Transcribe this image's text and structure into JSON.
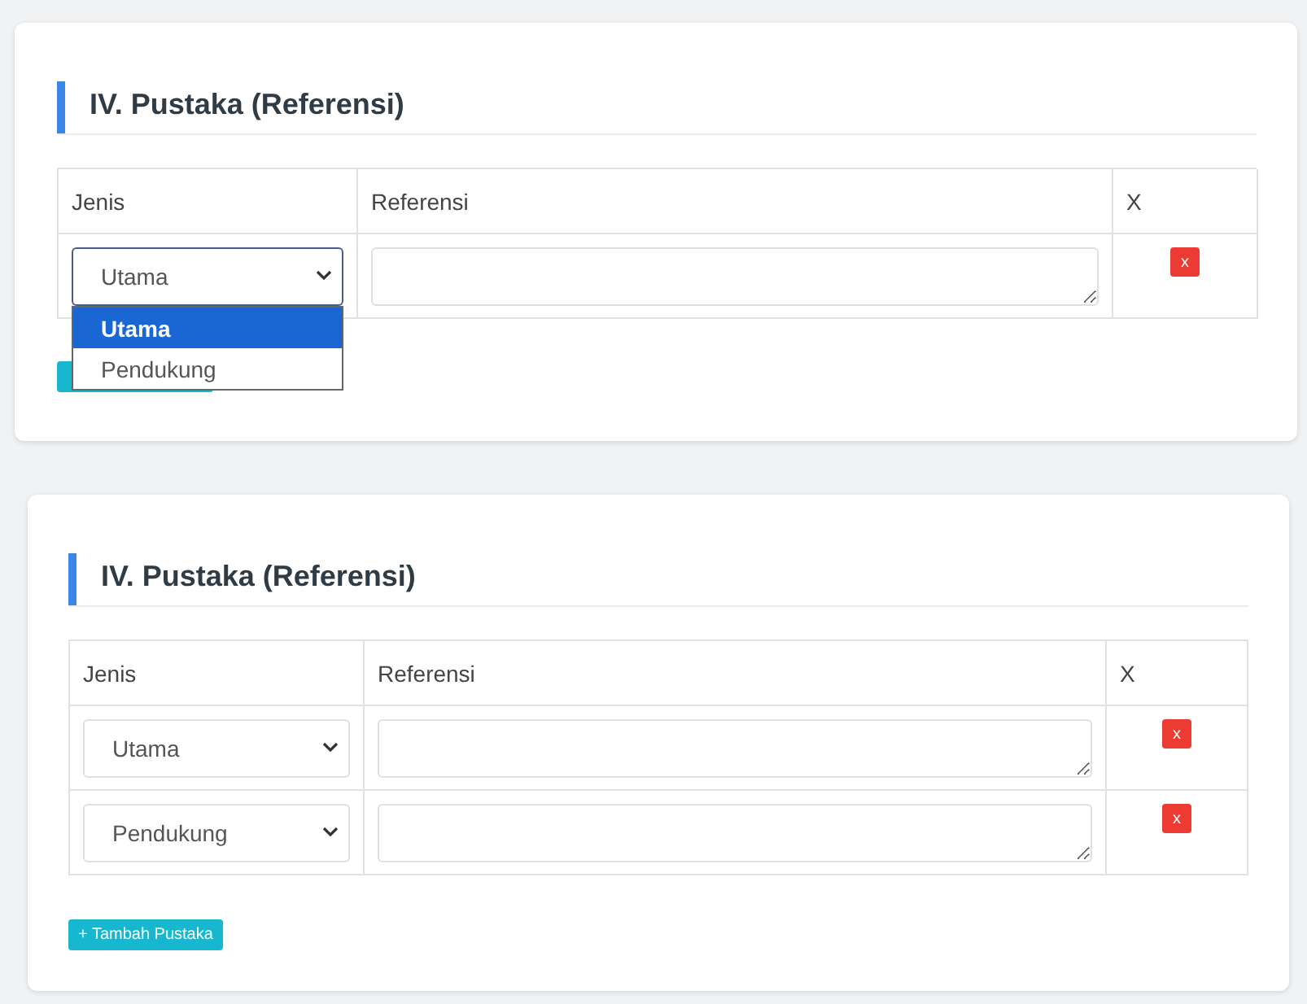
{
  "cards": [
    {
      "title": "IV. Pustaka (Referensi)",
      "columns": [
        "Jenis",
        "Referensi",
        "X"
      ],
      "rows": [
        {
          "jenis": "Utama",
          "delete": "x",
          "dropdown": {
            "options": [
              {
                "label": "Utama",
                "selected": true
              },
              {
                "label": "Pendukung",
                "selected": false
              }
            ]
          }
        }
      ],
      "add_button": {
        "kind": "covered"
      }
    },
    {
      "title": "IV. Pustaka (Referensi)",
      "columns": [
        "Jenis",
        "Referensi",
        "X"
      ],
      "rows": [
        {
          "jenis": "Utama",
          "delete": "x"
        },
        {
          "jenis": "Pendukung",
          "delete": "x"
        }
      ],
      "add_button": {
        "kind": "labeled",
        "label": "+ Tambah Pustaka"
      }
    }
  ]
}
